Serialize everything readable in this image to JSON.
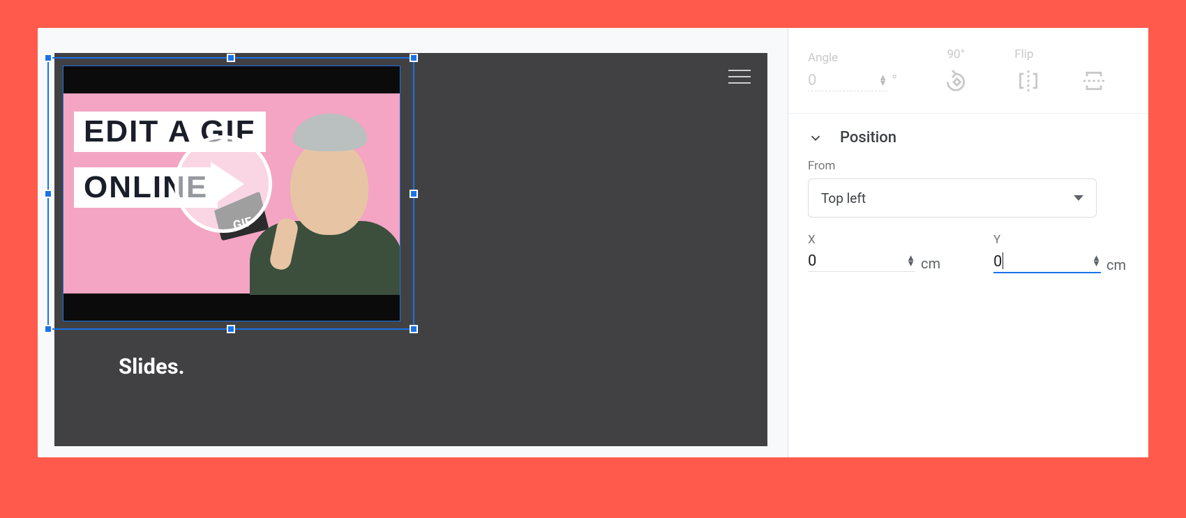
{
  "slide": {
    "visible_text": "Slides.",
    "menu_icon": "hamburger-icon"
  },
  "video_thumb": {
    "line1": "EDIT A GIF",
    "line2": "ONLINE",
    "badge": "GIF",
    "play_icon": "play-icon"
  },
  "rotation": {
    "angle_label": "Angle",
    "angle_value": "0",
    "degree_symbol": "°",
    "ninety_label": "90°",
    "flip_label": "Flip"
  },
  "position": {
    "header": "Position",
    "from_label": "From",
    "from_value": "Top left",
    "x_label": "X",
    "x_value": "0",
    "x_unit": "cm",
    "y_label": "Y",
    "y_value": "0",
    "y_unit": "cm",
    "y_focused": true
  }
}
